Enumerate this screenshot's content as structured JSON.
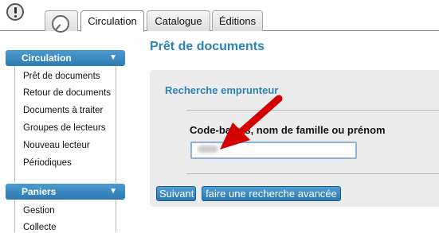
{
  "tabs": [
    {
      "label": ""
    },
    {
      "label": "Circulation"
    },
    {
      "label": "Catalogue"
    },
    {
      "label": "Éditions"
    }
  ],
  "sidebar": {
    "sections": [
      {
        "title": "Circulation",
        "items": [
          "Prêt de documents",
          "Retour de documents",
          "Documents à traiter",
          "Groupes de lecteurs",
          "Nouveau lecteur",
          "Périodiques"
        ]
      },
      {
        "title": "Paniers",
        "items": [
          "Gestion",
          "Collecte"
        ]
      }
    ]
  },
  "main": {
    "title": "Prêt de documents",
    "fieldset_legend": "Recherche emprunteur",
    "field_label": "Code-barres, nom de famille ou prénom",
    "field_value": "",
    "submit_label": "Suivant",
    "advanced_label": "faire une recherche avancée"
  },
  "colors": {
    "accent": "#2a84b9",
    "button": "#2c78b0",
    "arrow": "#d40000"
  }
}
